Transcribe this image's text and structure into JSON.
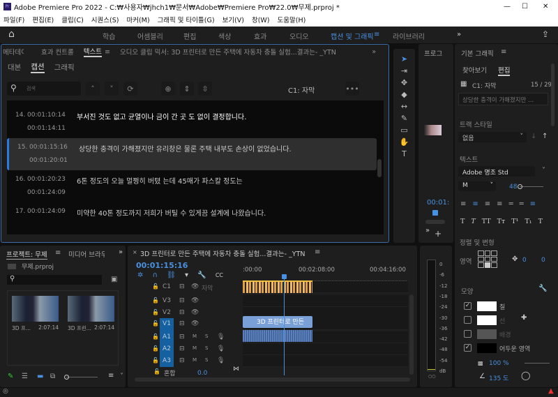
{
  "window": {
    "title": "Adobe Premiere Pro 2022 - C:₩사용자₩jhch1₩문서₩Adobe₩Premiere Pro₩22.0₩무제.prproj *",
    "min": "—",
    "max": "☐",
    "close": "✕"
  },
  "menu": [
    "파일(F)",
    "편집(E)",
    "클립(C)",
    "시퀀스(S)",
    "마커(M)",
    "그래픽 및 타이틀(G)",
    "보기(V)",
    "창(W)",
    "도움말(H)"
  ],
  "workspaces": [
    "학습",
    "어셈블리",
    "편집",
    "색상",
    "효과",
    "오디오",
    "캡션 및 그래픽",
    "라이브러리"
  ],
  "workspace_active": "캡션 및 그래픽",
  "text_panel": {
    "tabs": [
      "메타데이터 범위",
      "효과 컨트롤",
      "텍스트",
      "오디오 클립 믹서: 3D 프린터로 만든 주택에 자동차 충돌 실험...결과는- _YTN"
    ],
    "subtabs": [
      "대본",
      "캡션",
      "그래픽"
    ],
    "search_placeholder": "검색",
    "track_label": "C1: 자막",
    "captions": [
      {
        "num": "",
        "start": "",
        "end": "00:01:10:14",
        "text": ""
      },
      {
        "num": "14.",
        "start": "00:01:10:14",
        "end": "00:01:14:11",
        "text": "부서진 것도 없고 균열이나 금이 간 곳 도 없이 결정합니다."
      },
      {
        "num": "15.",
        "start": "00:01:15:16",
        "end": "00:01:20:01",
        "text": "상당한 충격이 가해졌지만 유리창은 물론 주택 내부도 손상이 없었습니다.",
        "selected": true
      },
      {
        "num": "16.",
        "start": "00:01:20:23",
        "end": "00:01:24:09",
        "text": "6톤 정도의 오늘 멀쩡히 버텼 는데 45매가 파스칼 정도는"
      },
      {
        "num": "17.",
        "start": "00:01:24:09",
        "end": "",
        "text": "미약한 40톤 정도까지 저희가 버틸 수 있게끔 설계에 나왔습니다."
      }
    ]
  },
  "program": {
    "title": "프로그",
    "timecode": "00:01:"
  },
  "graphics": {
    "title": "기본 그래픽",
    "tabs": [
      "찾아보기",
      "편집"
    ],
    "layer": "C1: 자막",
    "count": "15 / 29",
    "caption_preview": "상당한 충격이 가해졌지만 ...",
    "track_style_label": "트랙 스타일",
    "track_style": "없음",
    "text_label": "텍스트",
    "font": "Adobe 명조 Std",
    "weight": "M",
    "size": "48",
    "align_label": "정렬 및 변형",
    "region_label": "영역",
    "pos_x": "0",
    "pos_y": "0",
    "appearance_label": "모양",
    "fill": {
      "label": "칠",
      "checked": true,
      "color": "#ffffff"
    },
    "stroke": {
      "label": "선",
      "checked": false,
      "color": "#ffffff"
    },
    "background": {
      "label": "배경",
      "checked": false,
      "color": "#555555"
    },
    "shadow": {
      "label": "어두운 영역",
      "checked": true,
      "color": "#000000"
    },
    "opacity": "100 %",
    "angle": "135 도"
  },
  "project": {
    "tabs": [
      "프로젝트: 무제",
      "미디어 브라우"
    ],
    "file": "무제.prproj",
    "items": [
      {
        "name": "3D 프...",
        "dur": "2:07:14"
      },
      {
        "name": "3D 프린...",
        "dur": "2:07:14"
      }
    ]
  },
  "timeline": {
    "title": "3D 프린터로 만든 주택에 자동차 충돌 실험...결과는- _YTN",
    "timecode": "00:01:15:16",
    "ruler": [
      ":00:00",
      "00:02:08:00",
      "00:04:16:00"
    ],
    "tracks": [
      {
        "id": "C1",
        "name": "자막"
      },
      {
        "id": "V3"
      },
      {
        "id": "V2"
      },
      {
        "id": "V1"
      },
      {
        "id": "A1",
        "m": "M",
        "s": "S"
      },
      {
        "id": "A2",
        "m": "M",
        "s": "S"
      },
      {
        "id": "A3",
        "m": "M",
        "s": "S"
      }
    ],
    "mix": {
      "label": "혼합",
      "value": "0.0"
    },
    "clip_label": "3D 프린터로 만든"
  },
  "meter": {
    "scale": [
      "0",
      "-6",
      "-12",
      "-18",
      "-24",
      "-30",
      "-36",
      "-42",
      "-48",
      "-54",
      "dB"
    ]
  }
}
